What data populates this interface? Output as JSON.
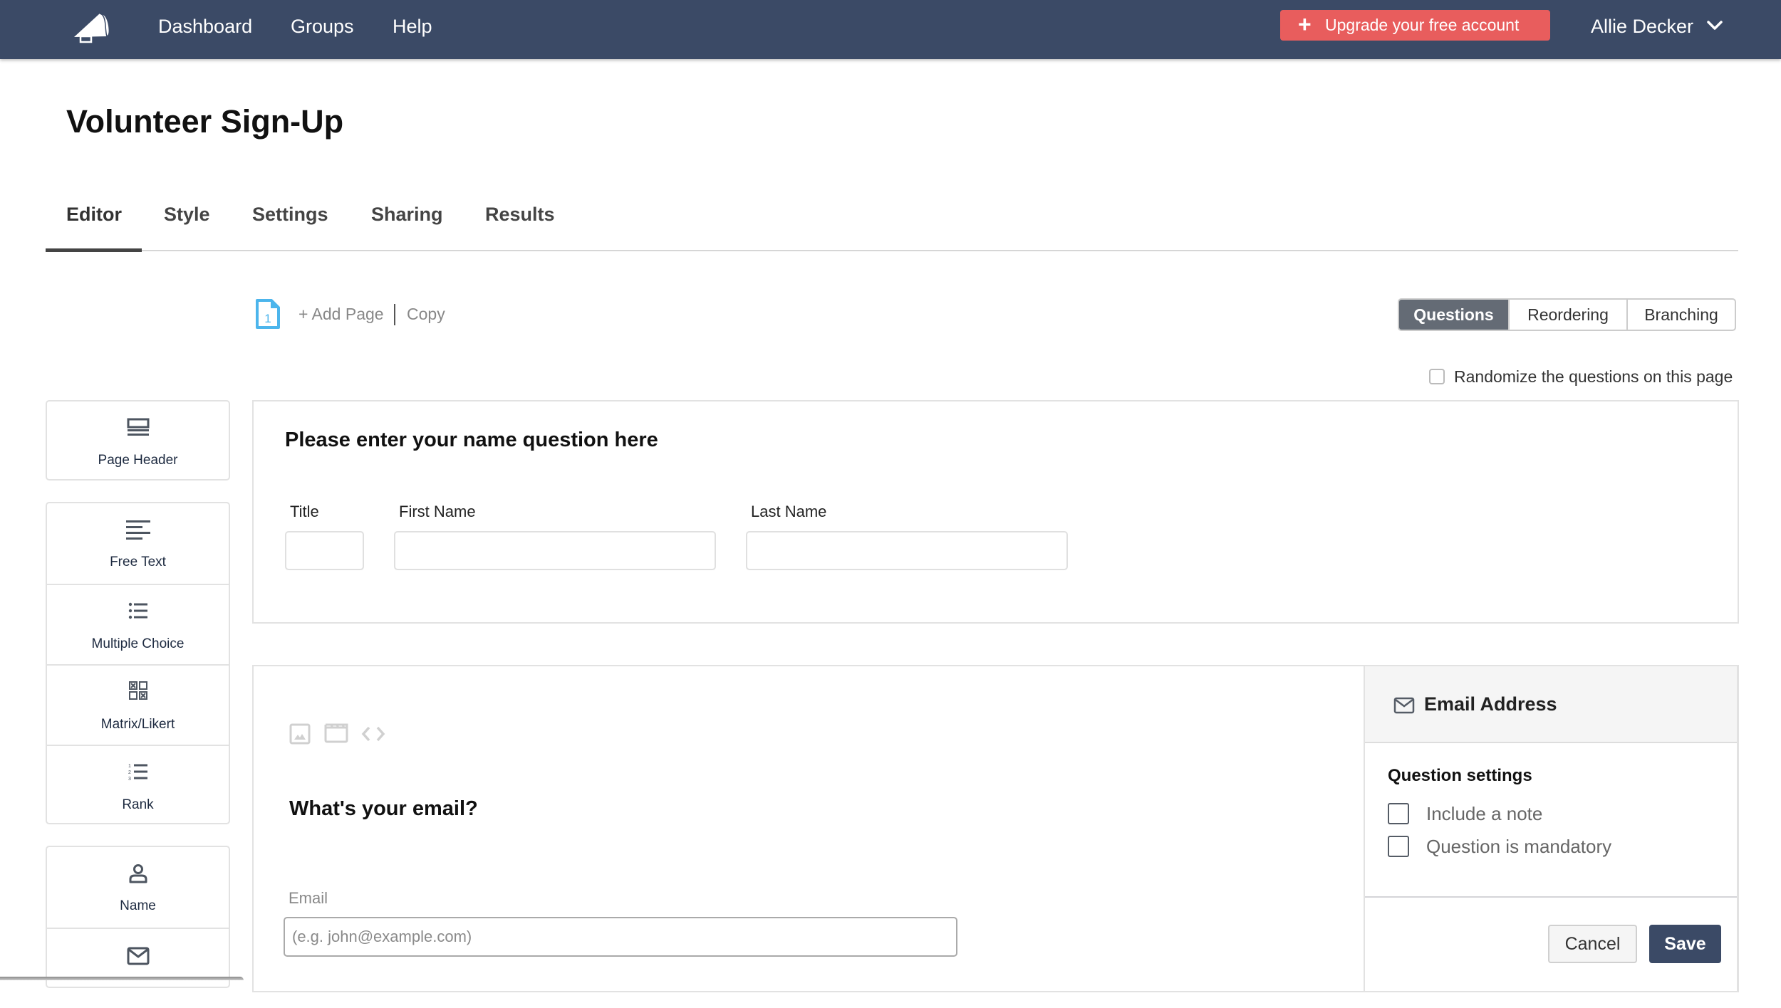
{
  "navbar": {
    "logo": "megaphone-icon",
    "links": [
      "Dashboard",
      "Groups",
      "Help"
    ],
    "upgrade_label": "Upgrade your free account",
    "upgrade_color": "#e85d5d",
    "user_name": "Allie Decker",
    "bg_color": "#3b4a66"
  },
  "page": {
    "title": "Volunteer Sign-Up",
    "tabs": [
      "Editor",
      "Style",
      "Settings",
      "Sharing",
      "Results"
    ],
    "active_tab": "Editor"
  },
  "toolbar": {
    "page_number": "1",
    "add_page": "+ Add Page",
    "copy": "Copy",
    "modes": [
      "Questions",
      "Reordering",
      "Branching"
    ],
    "active_mode": "Questions",
    "randomize_label": "Randomize the questions on this page",
    "randomize_checked": false
  },
  "sidebar": {
    "groups": [
      [
        {
          "label": "Page Header",
          "icon": "page-header-icon"
        }
      ],
      [
        {
          "label": "Free Text",
          "icon": "free-text-icon"
        },
        {
          "label": "Multiple Choice",
          "icon": "list-icon"
        },
        {
          "label": "Matrix/Likert",
          "icon": "matrix-icon"
        },
        {
          "label": "Rank",
          "icon": "ordered-list-icon"
        }
      ],
      [
        {
          "label": "Name",
          "icon": "person-icon"
        },
        {
          "label": "",
          "icon": "envelope-icon"
        }
      ]
    ]
  },
  "name_question": {
    "heading": "Please enter your name question here",
    "fields": [
      {
        "label": "Title",
        "value": ""
      },
      {
        "label": "First Name",
        "value": ""
      },
      {
        "label": "Last Name",
        "value": ""
      }
    ]
  },
  "email_question": {
    "media_icons": [
      "image-icon",
      "video-icon",
      "code-icon"
    ],
    "heading": "What's your email?",
    "field_label": "Email",
    "placeholder": "(e.g. john@example.com)",
    "value": ""
  },
  "settings_panel": {
    "title": "Email Address",
    "section_title": "Question settings",
    "options": [
      {
        "label": "Include a note",
        "checked": false
      },
      {
        "label": "Question is mandatory",
        "checked": false
      }
    ],
    "cancel_label": "Cancel",
    "save_label": "Save"
  }
}
